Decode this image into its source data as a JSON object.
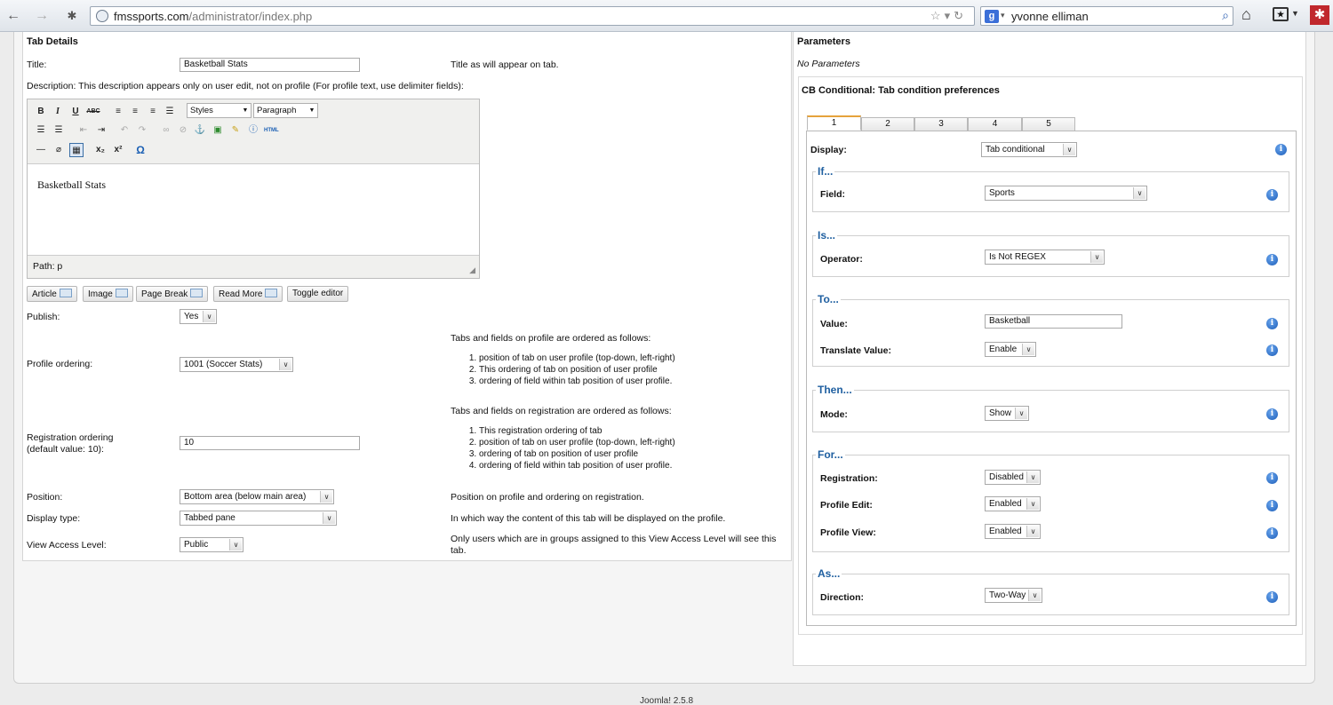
{
  "browser": {
    "url_host": "fmssports.com",
    "url_path": "/administrator/index.php",
    "search_text": "yvonne elliman",
    "search_engine_icon": "google-icon"
  },
  "tab_details": {
    "heading": "Tab Details",
    "title_label": "Title:",
    "title_value": "Basketball Stats",
    "title_hint": "Title as will appear on tab.",
    "description_label": "Description: This description appears only on user edit, not on profile (For profile text, use delimiter fields):",
    "editor": {
      "styles_select": "Styles",
      "format_select": "Paragraph",
      "content": "Basketball Stats",
      "path": "Path: p"
    },
    "editor_buttons": [
      "Article",
      "Image",
      "Page Break",
      "Read More",
      "Toggle editor"
    ],
    "publish_label": "Publish:",
    "publish_value": "Yes",
    "profile_ordering_label": "Profile ordering:",
    "profile_ordering_value": "1001 (Soccer Stats)",
    "profile_ordering_heading": "Tabs and fields on profile are ordered as follows:",
    "profile_ordering_items": [
      "position of tab on user profile (top-down, left-right)",
      "This ordering of tab on position of user profile",
      "ordering of field within tab position of user profile."
    ],
    "registration_ordering_label_1": "Registration ordering",
    "registration_ordering_label_2": "(default value: 10):",
    "registration_ordering_value": "10",
    "registration_ordering_heading": "Tabs and fields on registration are ordered as follows:",
    "registration_ordering_items": [
      "This registration ordering of tab",
      "position of tab on user profile (top-down, left-right)",
      "ordering of tab on position of user profile",
      "ordering of field within tab position of user profile."
    ],
    "position_label": "Position:",
    "position_value": "Bottom area (below main area)",
    "position_hint": "Position on profile and ordering on registration.",
    "display_type_label": "Display type:",
    "display_type_value": "Tabbed pane",
    "display_type_hint": "In which way the content of this tab will be displayed on the profile.",
    "view_access_label": "View Access Level:",
    "view_access_value": "Public",
    "view_access_hint_1": "Only users which are in groups assigned to this View Access Level will see this",
    "view_access_hint_2": "tab."
  },
  "parameters": {
    "heading": "Parameters",
    "no_params": "No Parameters",
    "cb_heading": "CB Conditional: Tab condition preferences",
    "tabs": [
      "1",
      "2",
      "3",
      "4",
      "5"
    ],
    "active_tab": "1",
    "display_label": "Display:",
    "display_value": "Tab conditional",
    "groups": {
      "if": "If...",
      "is": "Is...",
      "to": "To...",
      "then": "Then...",
      "for": "For...",
      "as": "As..."
    },
    "field_label": "Field:",
    "field_value": "Sports",
    "operator_label": "Operator:",
    "operator_value": "Is Not REGEX",
    "value_label": "Value:",
    "value_value": "Basketball",
    "translate_label": "Translate Value:",
    "translate_value": "Enable",
    "mode_label": "Mode:",
    "mode_value": "Show",
    "registration_label": "Registration:",
    "registration_value": "Disabled",
    "profile_edit_label": "Profile Edit:",
    "profile_edit_value": "Enabled",
    "profile_view_label": "Profile View:",
    "profile_view_value": "Enabled",
    "direction_label": "Direction:",
    "direction_value": "Two-Way"
  },
  "footer": {
    "version": "Joomla! 2.5.8"
  }
}
